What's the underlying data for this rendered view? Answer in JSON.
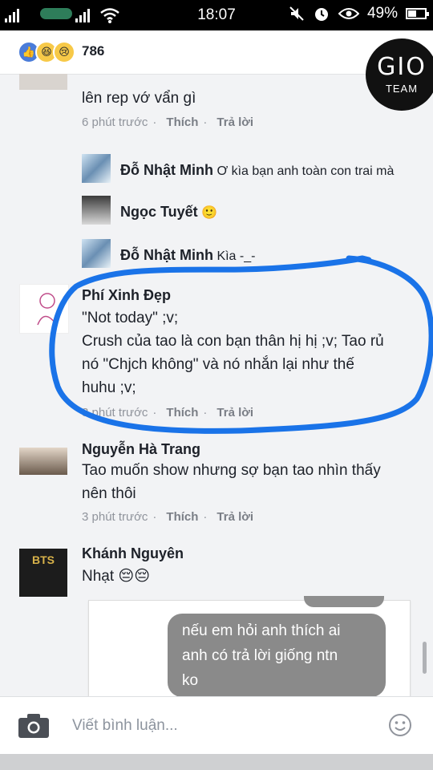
{
  "status": {
    "time": "18:07",
    "battery": "49%"
  },
  "reactions": {
    "count": "786"
  },
  "logo": {
    "line1": "GIO",
    "line2": "TEAM"
  },
  "comments": [
    {
      "text_partial": "lên rep vớ vẩn gì",
      "time": "6 phút trước",
      "like": "Thích",
      "reply": "Trả lời"
    },
    {
      "name": "Đỗ Nhật Minh",
      "text": "Ơ kìa bạn anh toàn con trai mà"
    },
    {
      "name": "Ngọc Tuyết",
      "text": "🙂"
    },
    {
      "name": "Đỗ Nhật Minh",
      "text": "Kìa -_-"
    },
    {
      "name": "Phí Xinh Đẹp",
      "line1": "\"Not today\" ;v;",
      "line2": "Crush của tao là con bạn thân hị hị ;v; Tao rủ",
      "line3": "nó \"Chjch không\" và nó nhắn lại như thế",
      "line4": "huhu ;v;",
      "time": "3 phút trước",
      "like": "Thích",
      "reply": "Trả lời"
    },
    {
      "name": "Nguyễn Hà Trang",
      "line1": "Tao muốn show nhưng sợ bạn tao nhìn thấy",
      "line2": "nên thôi",
      "time": "3 phút trước",
      "like": "Thích",
      "reply": "Trả lời"
    },
    {
      "name": "Khánh Nguyên",
      "text": "Nhạt 😔😔"
    }
  ],
  "chat_bubble": {
    "line1": "nếu em hỏi anh thích ai",
    "line2": "anh có trả lời giống ntn",
    "line3": "ko"
  },
  "composer": {
    "placeholder": "Viết bình luận..."
  },
  "colors": {
    "highlight": "#1a73e8",
    "meta": "#90949c"
  }
}
